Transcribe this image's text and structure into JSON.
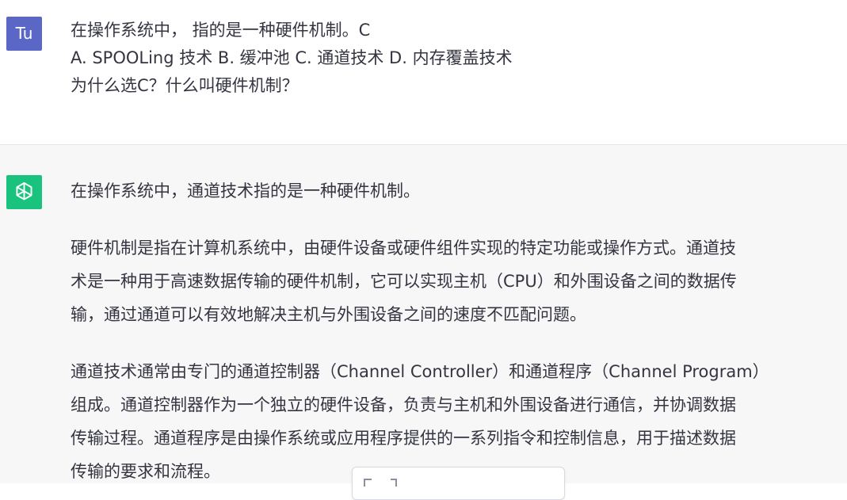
{
  "user_message": {
    "avatar_initials": "Tu",
    "lines": [
      "在操作系统中， 指的是一种硬件机制。C",
      "A. SPOOLing 技术 B. 缓冲池 C. 通道技术 D. 内存覆盖技术",
      "为什么选C？什么叫硬件机制？"
    ]
  },
  "assistant_message": {
    "avatar_icon": "openai-logo-icon",
    "paragraphs": [
      [
        "在操作系统中，通道技术指的是一种硬件机制。"
      ],
      [
        "硬件机制是指在计算机系统中，由硬件设备或硬件组件实现的特定功能或操作方式。通道技",
        "术是一种用于高速数据传输的硬件机制，它可以实现主机（CPU）和外围设备之间的数据传",
        "输，通过通道可以有效地解决主机与外围设备之间的速度不匹配问题。"
      ],
      [
        "通道技术通常由专门的通道控制器（Channel Controller）和通道程序（Channel Program）",
        "组成。通道控制器作为一个独立的硬件设备，负责与主机和外围设备进行通信，并协调数据",
        "传输过程。通道程序是由操作系统或应用程序提供的一系列指令和控制信息，用于描述数据",
        "传输的要求和流程。"
      ]
    ]
  },
  "colors": {
    "user_avatar_bg": "#5b67c7",
    "assistant_avatar_bg": "#19c37d",
    "assistant_bg": "#f7f7f8",
    "text": "#343541"
  }
}
